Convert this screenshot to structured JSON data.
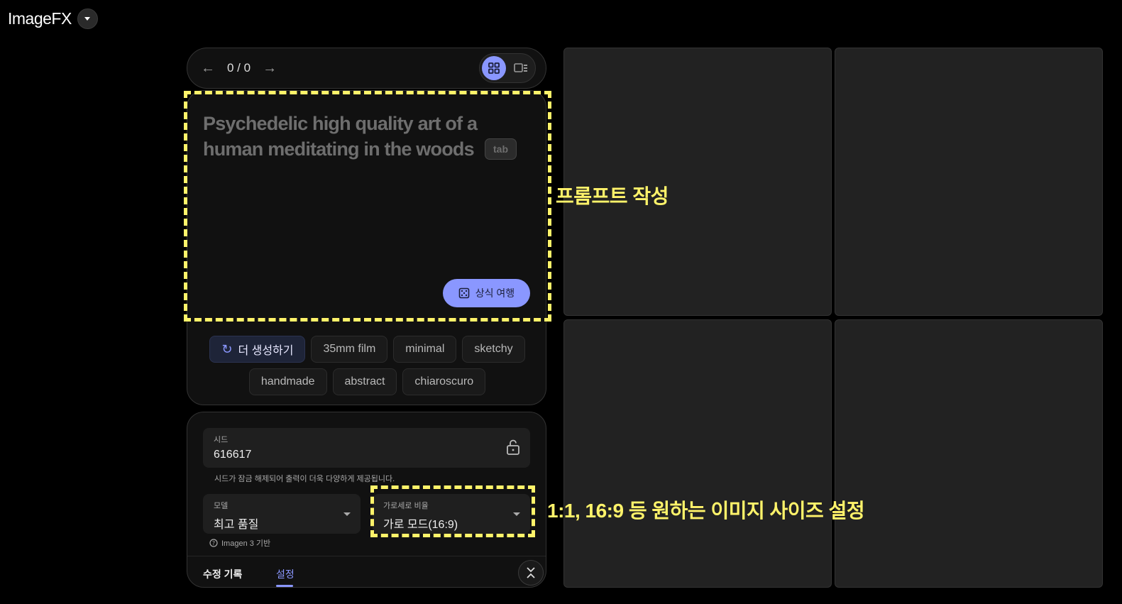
{
  "app": {
    "title": "ImageFX"
  },
  "nav": {
    "pager": "0 / 0"
  },
  "prompt": {
    "placeholder": "Psychedelic high quality art of a human meditating in the woods",
    "tab_hint": "tab",
    "travel_button": "상식 여행"
  },
  "chips": {
    "generate_more": "더 생성하기",
    "items": [
      "35mm film",
      "minimal",
      "sketchy",
      "handmade",
      "abstract",
      "chiaroscuro"
    ]
  },
  "settings": {
    "seed_label": "시드",
    "seed_value": "616617",
    "seed_hint": "시드가 잠금 해제되어 출력이 더욱 다양하게 제공됩니다.",
    "model_label": "모델",
    "model_value": "최고 품질",
    "model_note": "Imagen 3 기반",
    "ratio_label": "가로세로 비율",
    "ratio_value": "가로 모드(16:9)",
    "tab_history": "수정 기록",
    "tab_settings": "설정"
  },
  "annotations": {
    "prompt": "프롬프트 작성",
    "ratio": "1:1, 16:9 등 원하는 이미지 사이즈 설정"
  },
  "colors": {
    "accent": "#8a97ff",
    "highlight": "#fff36a",
    "background": "#000000",
    "panel": "#111111"
  }
}
